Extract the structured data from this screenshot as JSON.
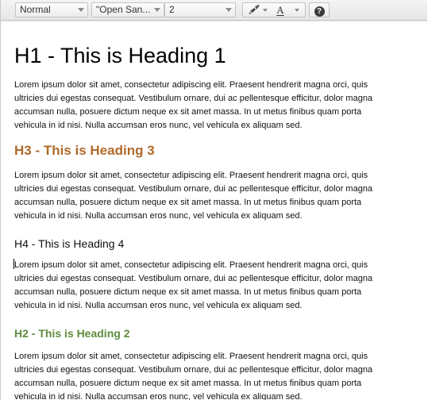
{
  "toolbar": {
    "style_combo": "Normal",
    "font_combo": "\"Open San...",
    "size_combo": "2",
    "text_color_letter": "A",
    "help_symbol": "?"
  },
  "icons": {
    "brush": "paint-brush-icon",
    "text_color": "text-color-icon",
    "help": "help-icon"
  },
  "colors": {
    "h3": "#b06a2a",
    "h2": "#5f8b3c",
    "spellcheck": "#d33"
  },
  "document": {
    "h1": "H1 - This is Heading 1",
    "h3": "H3 - This is Heading 3",
    "h4": "H4 - This is Heading 4",
    "h2": "H2 - This is Heading 2",
    "lorem_lines": [
      "Lorem ipsum dolor sit amet, consectetur adipiscing elit. Praesent hendrerit magna orci, quis",
      "ultricies dui egestas consequat. Vestibulum ornare, dui ac pellentesque efficitur, dolor magna",
      "accumsan nulla, posuere dictum neque ex sit amet massa. In ut metus finibus quam porta",
      "vehicula in id nisi. Nulla accumsan eros nunc, vel vehicula ex aliquam sed."
    ]
  }
}
